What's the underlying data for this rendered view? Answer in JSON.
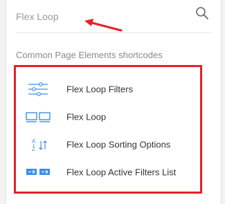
{
  "search": {
    "placeholder": "Flex Loop"
  },
  "section": {
    "title": "Common Page Elements shortcodes"
  },
  "items": [
    {
      "label": "Flex Loop Filters",
      "icon": "sliders-icon"
    },
    {
      "label": "Flex Loop",
      "icon": "grid-two-columns-icon"
    },
    {
      "label": "Flex Loop Sorting Options",
      "icon": "sort-az-icon"
    },
    {
      "label": "Flex Loop Active Filters List",
      "icon": "active-filters-tags-icon"
    }
  ],
  "colors": {
    "accent": "#3b8ee8",
    "highlight": "#e8202a",
    "text": "#333333",
    "muted": "#8a8a8a"
  }
}
